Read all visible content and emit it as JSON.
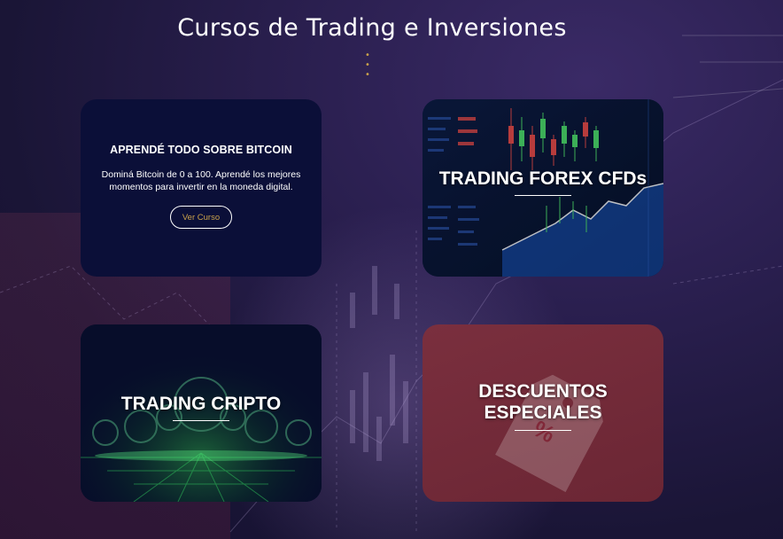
{
  "page": {
    "title": "Cursos de Trading e Inversiones",
    "dots": "• • •"
  },
  "cards": {
    "bitcoin": {
      "title": "APRENDÉ TODO SOBRE BITCOIN",
      "description": "Dominá Bitcoin de 0 a 100. Aprendé los mejores momentos para invertir en la moneda digital.",
      "button_label": "Ver Curso"
    },
    "forex": {
      "label": "TRADING FOREX CFDs"
    },
    "cripto": {
      "label": "TRADING CRIPTO"
    },
    "descuentos": {
      "label_line1": "DESCUENTOS",
      "label_line2": "ESPECIALES"
    }
  },
  "colors": {
    "accent_gold": "#c9a14a",
    "card_navy": "#0b0f38",
    "card_maroon": "#7a2f3e"
  }
}
